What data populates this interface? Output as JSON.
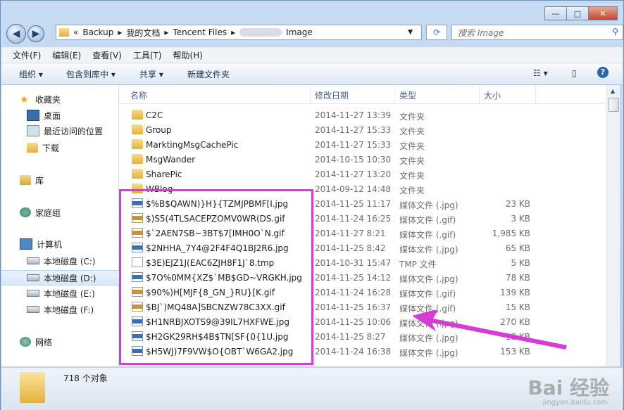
{
  "window": {
    "minimize": "—",
    "maximize": "□",
    "close": "✕"
  },
  "nav": {
    "back": "◀",
    "forward": "▶",
    "breadcrumb": [
      "«",
      "Backup",
      "▸",
      "我的文档",
      "▸",
      "Tencent Files",
      "▸",
      "Image"
    ],
    "search_placeholder": "搜索 Image"
  },
  "menu": [
    "文件(F)",
    "编辑(E)",
    "查看(V)",
    "工具(T)",
    "帮助(H)"
  ],
  "toolbar": {
    "organize": "组织 ▾",
    "include": "包含到库中 ▾",
    "share": "共享 ▾",
    "new_folder": "新建文件夹"
  },
  "sidebar": [
    {
      "label": "收藏夹",
      "icon": "star-icon"
    },
    {
      "label": "桌面",
      "icon": "desktop-icon"
    },
    {
      "label": "最近访问的位置",
      "icon": "recent-places-icon"
    },
    {
      "label": "下载",
      "icon": "download-icon"
    },
    {
      "label": "库",
      "icon": "library-icon"
    },
    {
      "label": "家庭组",
      "icon": "homegroup-icon"
    },
    {
      "label": "计算机",
      "icon": "computer-icon"
    },
    {
      "label": "本地磁盘 (C:)",
      "icon": "drive-icon"
    },
    {
      "label": "本地磁盘 (D:)",
      "icon": "drive-icon"
    },
    {
      "label": "本地磁盘 (E:)",
      "icon": "drive-icon"
    },
    {
      "label": "本地磁盘 (F:)",
      "icon": "drive-icon"
    },
    {
      "label": "网络",
      "icon": "network-icon"
    }
  ],
  "columns": {
    "name": "名称",
    "date": "修改日期",
    "type": "类型",
    "size": "大小"
  },
  "files": [
    {
      "name": "C2C",
      "date": "2014-11-27 13:39",
      "type": "文件夹",
      "size": "",
      "icon": "folder"
    },
    {
      "name": "Group",
      "date": "2014-11-27 15:33",
      "type": "文件夹",
      "size": "",
      "icon": "folder"
    },
    {
      "name": "MarktingMsgCachePic",
      "date": "2014-11-27 15:33",
      "type": "文件夹",
      "size": "",
      "icon": "folder"
    },
    {
      "name": "MsgWander",
      "date": "2014-10-15 10:30",
      "type": "文件夹",
      "size": "",
      "icon": "folder"
    },
    {
      "name": "SharePic",
      "date": "2014-11-27 13:20",
      "type": "文件夹",
      "size": "",
      "icon": "folder"
    },
    {
      "name": "WBlog",
      "date": "2014-09-12 14:48",
      "type": "文件夹",
      "size": "",
      "icon": "folder"
    },
    {
      "name": "$%B$QAWN)}H}{TZMJPBMF[I.jpg",
      "date": "2014-11-25 11:17",
      "type": "媒体文件 (.jpg)",
      "size": "23 KB",
      "icon": "jpg"
    },
    {
      "name": "$)S5(4TLSACEPZOMV0WR(DS.gif",
      "date": "2014-11-24 16:25",
      "type": "媒体文件 (.gif)",
      "size": "3 KB",
      "icon": "gif"
    },
    {
      "name": "$`2AEN7SB~3BT$7[IMH0O`N.gif",
      "date": "2014-11-27 8:21",
      "type": "媒体文件 (.gif)",
      "size": "1,985 KB",
      "icon": "gif"
    },
    {
      "name": "$2NHHA_7Y4@2F4F4Q1BJ2R6.jpg",
      "date": "2014-11-25 8:42",
      "type": "媒体文件 (.jpg)",
      "size": "65 KB",
      "icon": "jpg"
    },
    {
      "name": "$3E)EJZ1J(EAC6ZJH8F1J`8.tmp",
      "date": "2014-10-31 15:47",
      "type": "TMP 文件",
      "size": "5 KB",
      "icon": "tmp"
    },
    {
      "name": "$7O%0MM{XZ$`MB$GD~VRGKH.jpg",
      "date": "2014-11-25 14:12",
      "type": "媒体文件 (.jpg)",
      "size": "78 KB",
      "icon": "jpg"
    },
    {
      "name": "$90%)H[MJF{8_GN_}RU}[K.gif",
      "date": "2014-11-24 16:28",
      "type": "媒体文件 (.gif)",
      "size": "139 KB",
      "icon": "gif"
    },
    {
      "name": "$BJ`)MQ48A]SBCNZW78C3XX.gif",
      "date": "2014-11-25 16:37",
      "type": "媒体文件 (.gif)",
      "size": "15 KB",
      "icon": "gif"
    },
    {
      "name": "$H1NRBJXOTS9@39IL7HXFWE.jpg",
      "date": "2014-11-25 10:06",
      "type": "媒体文件 (.jpg)",
      "size": "270 KB",
      "icon": "jpg"
    },
    {
      "name": "$H2GK29RH$4B$TN[SF{0{1U.jpg",
      "date": "2014-11-25 8:27",
      "type": "媒体文件 (.jpg)",
      "size": "18 KB",
      "icon": "jpg"
    },
    {
      "name": "$H5WJ)7F9VW$O{OBT`W6GA2.jpg",
      "date": "2014-11-24 16:38",
      "type": "媒体文件 (.jpg)",
      "size": "153 KB",
      "icon": "jpg"
    }
  ],
  "status": {
    "count": "718 个对象"
  },
  "watermark": {
    "main": "Bai 经验",
    "sub": "jingyan.baidu.com"
  },
  "colors": {
    "highlight": "#d63bd6",
    "accent": "#3b6fb5"
  }
}
